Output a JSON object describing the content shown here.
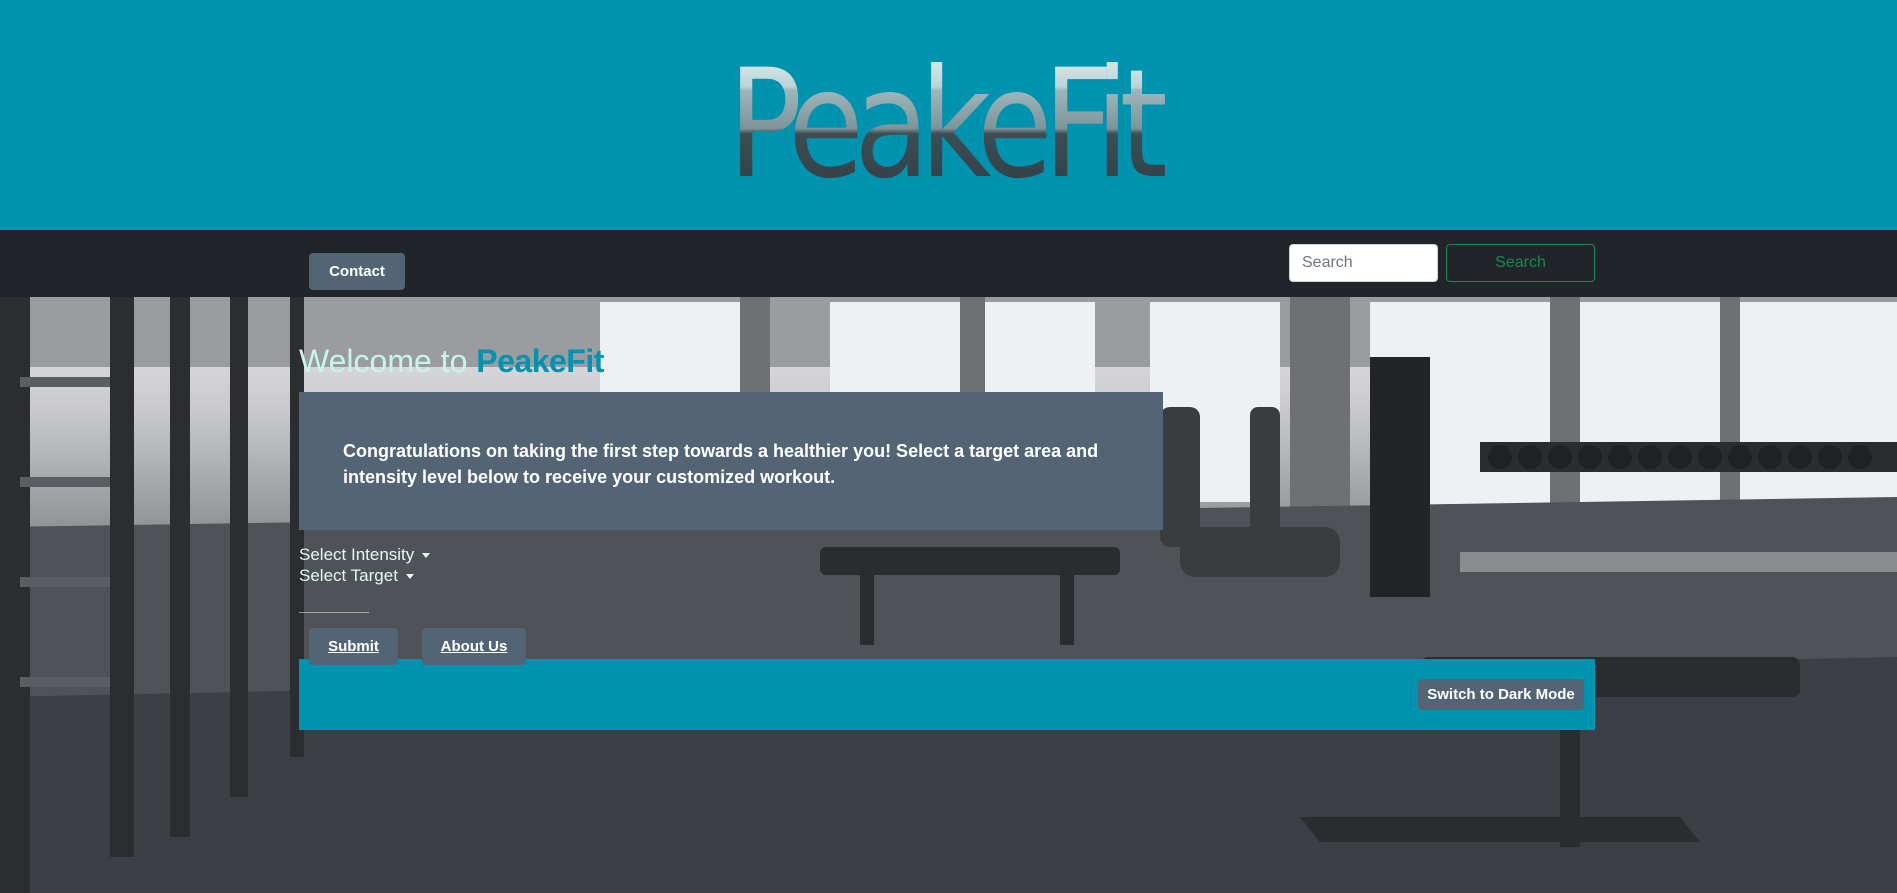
{
  "header": {
    "logo_text": "PeakeFit",
    "brand_color": "#0093b0"
  },
  "navbar": {
    "contact_label": "Contact",
    "search_placeholder": "Search",
    "search_button_label": "Search"
  },
  "hero": {
    "welcome_prefix": "Welcome to ",
    "welcome_brand": "PeakeFit",
    "intro_text": "Congratulations on taking the first step towards a healthier you! Select a target area and intensity level below to receive your customized workout.",
    "select_intensity_label": "Select Intensity",
    "select_target_label": "Select Target",
    "submit_label": "Submit",
    "about_label": "About Us"
  },
  "footer": {
    "dark_mode_label": "Switch to Dark Mode"
  },
  "colors": {
    "banner": "#0093b0",
    "navbar": "#212529",
    "button_grey": "#536575",
    "search_green": "#198754",
    "welcome_text": "#c6f5ec"
  }
}
